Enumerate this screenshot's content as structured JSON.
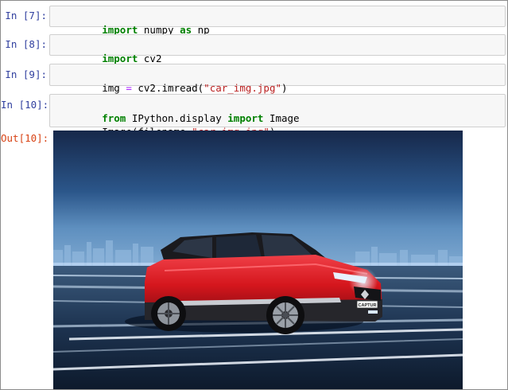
{
  "cells": [
    {
      "prompt": "In [7]:",
      "tokens": [
        {
          "text": "import",
          "cls": "kw"
        },
        {
          "text": " numpy ",
          "cls": ""
        },
        {
          "text": "as",
          "cls": "kw"
        },
        {
          "text": " np",
          "cls": ""
        }
      ]
    },
    {
      "prompt": "In [8]:",
      "tokens": [
        {
          "text": "import",
          "cls": "kw"
        },
        {
          "text": " cv2",
          "cls": ""
        }
      ]
    },
    {
      "prompt": "In [9]:",
      "tokens": [
        {
          "text": "img ",
          "cls": ""
        },
        {
          "text": "=",
          "cls": "op"
        },
        {
          "text": " cv2.imread(",
          "cls": ""
        },
        {
          "text": "\"car_img.jpg\"",
          "cls": "str"
        },
        {
          "text": ")",
          "cls": ""
        }
      ]
    },
    {
      "prompt": "In [10]:",
      "line1": [
        {
          "text": "from",
          "cls": "kw"
        },
        {
          "text": " IPython.display ",
          "cls": ""
        },
        {
          "text": "import",
          "cls": "kw"
        },
        {
          "text": " Image",
          "cls": ""
        }
      ],
      "line2": [
        {
          "text": "Image(filename",
          "cls": ""
        },
        {
          "text": "=",
          "cls": "op"
        },
        {
          "text": "\"car_img.jpg\"",
          "cls": "str"
        },
        {
          "text": ")",
          "cls": ""
        }
      ]
    }
  ],
  "output": {
    "prompt": "Out[10]:",
    "image_subject": "red Renault Captur SUV on a night road with city skyline",
    "plate_text": "CAPTUR"
  },
  "colors": {
    "keyword": "#008000",
    "string": "#ba2121",
    "operator": "#aa22ff",
    "in_prompt": "#303f9f",
    "out_prompt": "#d84315",
    "car_red": "#d5161d"
  }
}
